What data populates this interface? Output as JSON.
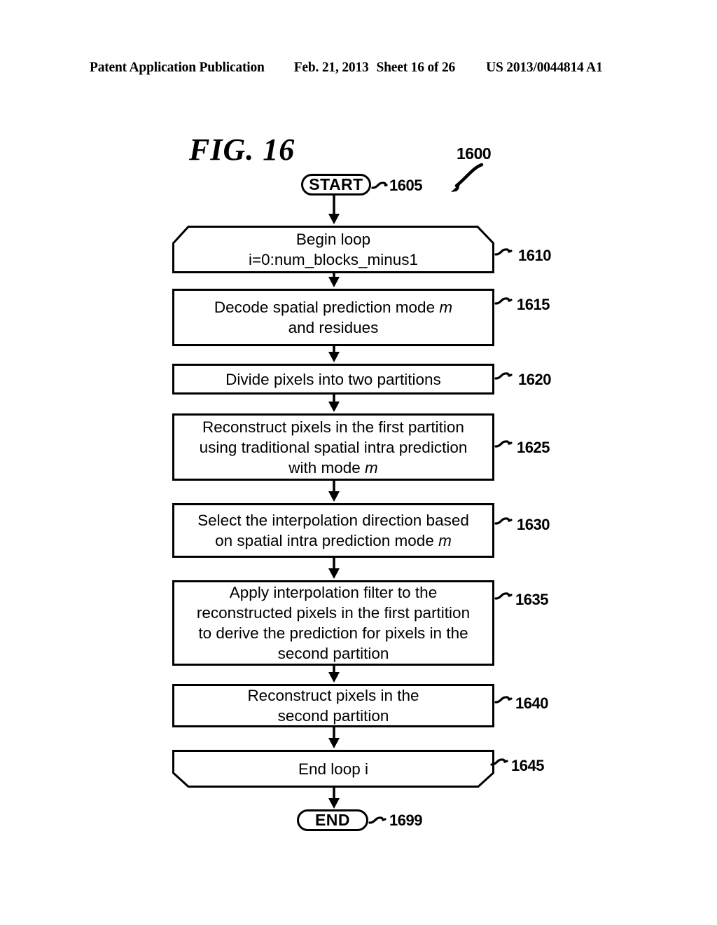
{
  "header": {
    "publication": "Patent Application Publication",
    "date": "Feb. 21, 2013",
    "sheet": "Sheet 16 of 26",
    "doc_number": "US 2013/0044814 A1"
  },
  "figure": {
    "title": "FIG. 16",
    "id_label": "1600",
    "id_arrow_icon": "curved-arrow-icon"
  },
  "flowchart": {
    "type": "flowchart",
    "orientation": "top-to-bottom",
    "nodes": [
      {
        "ref": "1605",
        "shape": "terminal",
        "text": "START",
        "lines": [
          "START"
        ]
      },
      {
        "ref": "1610",
        "shape": "loop-begin",
        "text": "Begin loop i=0:num_blocks_minus1",
        "lines": [
          "Begin loop",
          "i=0:num_blocks_minus1"
        ]
      },
      {
        "ref": "1615",
        "shape": "process",
        "text": "Decode spatial prediction mode m and residues",
        "lines": [
          "Decode spatial prediction mode m",
          "and residues"
        ],
        "line1_pre": "Decode spatial prediction mode ",
        "line1_italic": "m",
        "line2": "and residues"
      },
      {
        "ref": "1620",
        "shape": "process",
        "text": "Divide pixels into two partitions",
        "lines": [
          "Divide pixels into two partitions"
        ]
      },
      {
        "ref": "1625",
        "shape": "process",
        "text": "Reconstruct pixels in the first partition using traditional spatial intra prediction with mode m",
        "lines": [
          "Reconstruct pixels in the first partition",
          "using traditional spatial intra prediction",
          "with mode m"
        ],
        "line1": "Reconstruct pixels in the first partition",
        "line2": "using traditional spatial intra prediction",
        "line3_pre": "with mode ",
        "line3_italic": "m"
      },
      {
        "ref": "1630",
        "shape": "process",
        "text": "Select the interpolation direction based on spatial intra prediction mode m",
        "lines": [
          "Select the interpolation direction based",
          "on spatial intra prediction mode m"
        ],
        "line1": "Select the interpolation direction based",
        "line2_pre": "on spatial intra prediction mode ",
        "line2_italic": "m"
      },
      {
        "ref": "1635",
        "shape": "process",
        "text": "Apply interpolation filter to the reconstructed pixels in the first partition to derive the prediction for pixels in the second partition",
        "lines": [
          "Apply interpolation filter to the",
          "reconstructed pixels in the first partition",
          "to derive the prediction for pixels in the",
          "second partition"
        ]
      },
      {
        "ref": "1640",
        "shape": "process",
        "text": "Reconstruct pixels in the second partition",
        "lines": [
          "Reconstruct pixels in the",
          "second partition"
        ]
      },
      {
        "ref": "1645",
        "shape": "loop-end",
        "text": "End loop i",
        "lines": [
          "End loop i"
        ]
      },
      {
        "ref": "1699",
        "shape": "terminal",
        "text": "END",
        "lines": [
          "END"
        ]
      }
    ],
    "connector_icon": "down-arrow-icon",
    "leader_icon": "squiggle-leader-icon",
    "colors": {
      "ink": "#000000",
      "paper": "#ffffff"
    }
  }
}
